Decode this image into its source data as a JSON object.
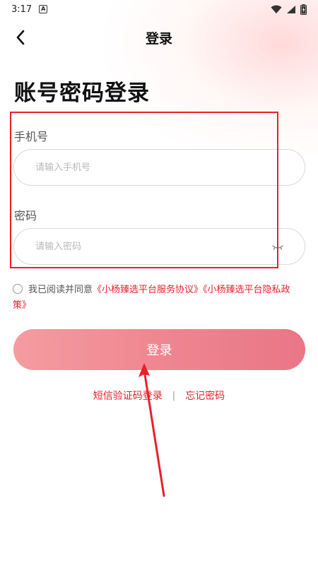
{
  "status_bar": {
    "time": "3:17",
    "notification_letter": "A"
  },
  "nav": {
    "title": "登录"
  },
  "heading": "账号密码登录",
  "phone_field": {
    "label": "手机号",
    "placeholder": "请输入手机号",
    "value": ""
  },
  "password_field": {
    "label": "密码",
    "placeholder": "请输入密码",
    "value": ""
  },
  "agreement": {
    "prefix": "我已阅读并同意",
    "service_link": "《小杨臻选平台服务协议》",
    "privacy_link": "《小杨臻选平台隐私政策》",
    "checked": false
  },
  "login_button": {
    "label": "登录"
  },
  "bottom_links": {
    "sms_login": "短信验证码登录",
    "separator": "|",
    "forgot_password": "忘记密码"
  },
  "colors": {
    "accent_red": "#e8202a",
    "button_gradient_start": "#f59ca1",
    "button_gradient_end": "#ea7686"
  },
  "icons": {
    "back": "chevron-left-icon",
    "password_toggle": "eye-closed-icon",
    "wifi": "wifi-icon",
    "signal": "signal-icon",
    "battery": "battery-icon"
  }
}
